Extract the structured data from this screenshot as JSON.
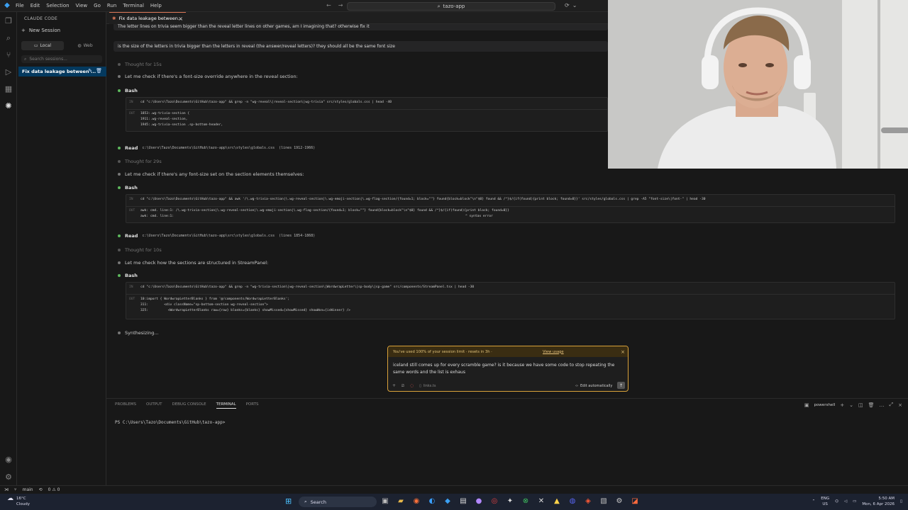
{
  "titlebar": {
    "menu": [
      "File",
      "Edit",
      "Selection",
      "View",
      "Go",
      "Run",
      "Terminal",
      "Help"
    ],
    "search_text": "tazo-app"
  },
  "sidebar": {
    "title": "CLAUDE CODE",
    "new_session": "New Session",
    "tab_local": "Local",
    "tab_web": "Web",
    "search_placeholder": "Search sessions...",
    "active_session": "Fix data leakage between ..."
  },
  "editor": {
    "tab_title": "Fix data leakage between..."
  },
  "chat": {
    "user_msg_1": "The letter lines on trivia seem bigger than the reveal letter lines on other games, am I imagining that? otherwise fix it",
    "user_msg_2": "is the size of the letters in trivia bigger than the letters in reveal (the answer/reveal letters)? they should all be the same font size",
    "thought_1": "Thought for 15s",
    "assist_1": "Let me check if there's a font-size override anywhere in the reveal section:",
    "bash_label": "Bash",
    "bash1_cmd": "cd \"c:\\Users\\Tazo\\Documents\\GitHub\\tazo-app\" && grep -n \"wg-reveal\\|reveal-section\\|wg-trivia\" src/styles/globals.css | head -40",
    "bash1_out": [
      "1853:.wg-trivia-section {",
      "1911:.wg-reveal-section,",
      "1945:.wg-trivia-section .sp-bottom-header,"
    ],
    "read_label": "Read",
    "read1_path": "c:\\Users\\Tazo\\Documents\\GitHub\\tazo-app\\src\\styles\\globals.css",
    "read1_lines": "(lines 1912-1966)",
    "thought_2": "Thought for 29s",
    "assist_2": "Let me check if there's any font-size set on the section elements themselves:",
    "bash2_cmd": "cd \"c:\\Users\\Tazo\\Documents\\GitHub\\tazo-app\" && awk '/\\.wg-trivia-section|\\.wg-reveal-section|\\.wg-emoji-section|\\.wg-flag-section/{found=1; block=\"\"} found{block=block\"\\n\"$0} found && /^}$/{if(found){print block; found=0}}' src/styles/globals.css | grep -A5 \"font-size\\|font-\" | head -30",
    "bash2_out": [
      "awk: cmd. line:1: /\\.wg-trivia-section|\\.wg-reveal-section|\\.wg-emoji-section|\\.wg-flag-section/{found=1; block=\"\"} found{block=block\"\\n\"$0} found && /^}$/{if(found){print block; found=0}}",
      "awk: cmd. line:1:",
      "^ syntax error"
    ],
    "read2_path": "c:\\Users\\Tazo\\Documents\\GitHub\\tazo-app\\src\\styles\\globals.css",
    "read2_lines": "(lines 1854-1868)",
    "thought_3": "Thought for 10s",
    "assist_3": "Let me check how the sections are structured in StreamPanel:",
    "bash3_cmd": "cd \"c:\\Users\\Tazo\\Documents\\GitHub\\tazo-app\" && grep -n \"wg-trivia-section\\|wg-reveal-section\\|WordwrapLetter\\|sp-body\\|sp-game\" src/components/StreamPanel.tsx | head -30",
    "bash3_out": [
      "10:import { WordwrapLetterBlanks } from '@/components/WordwrapLetterBlanks';",
      "311:        <div className=\"sp-bottom-section wg-reveal-section\">",
      "325:          <WordwrapLetterBlanks raw={raw} blanks={blanks} showMissed={showMissed} showWon={isWinner} />"
    ],
    "synth": "Synthesizing...",
    "in_label": "IN",
    "out_label": "OUT"
  },
  "composer": {
    "banner": "You've used 100% of your session limit · resets in 3h ·",
    "banner_link": "View usage",
    "input_text": "iceland still comes up for every scramble game? is it because we have some code to stop repeating the same words and the list is exhaus",
    "file_chip": "links.ts",
    "edit_mode": "Edit automatically"
  },
  "panel": {
    "tabs": [
      "PROBLEMS",
      "OUTPUT",
      "DEBUG CONSOLE",
      "TERMINAL",
      "PORTS"
    ],
    "shell": "powershell",
    "prompt": "PS C:\\Users\\Tazo\\Documents\\GitHub\\tazo-app>"
  },
  "status": {
    "branch": "main",
    "problems": "0 ⚠ 0"
  },
  "taskbar": {
    "temp": "16°C",
    "weather": "Cloudy",
    "search": "Search",
    "lang1": "ENG",
    "lang2": "US",
    "time": "5:50 AM",
    "date": "Mon, 6 Apr 2026"
  },
  "colors": {
    "accent": "#d97757",
    "selection": "#04395e",
    "warning_border": "#d9a23a"
  }
}
